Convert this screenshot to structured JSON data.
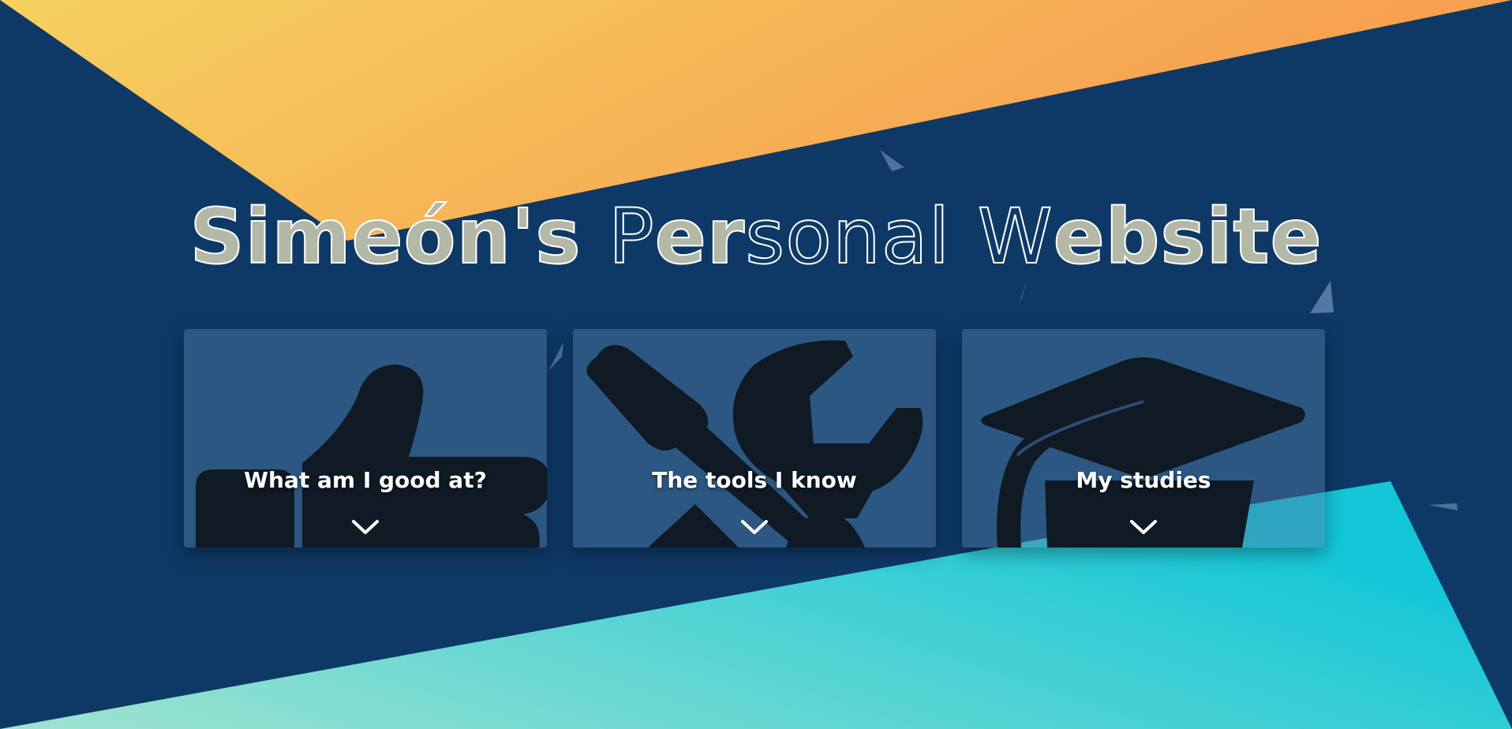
{
  "page": {
    "title_part1": "Simeón's",
    "title_part2": "P",
    "title_part3": "er",
    "title_part4": "sonal",
    "title_part5": "W",
    "title_part6": "ebsite"
  },
  "cards": [
    {
      "label": "What am I good at?",
      "icon": "thumbs-up-icon"
    },
    {
      "label": "The tools I know",
      "icon": "tools-icon"
    },
    {
      "label": "My studies",
      "icon": "graduation-cap-icon"
    }
  ],
  "colors": {
    "background": "#0e3966",
    "top_gradient_start": "#f5d25f",
    "top_gradient_end": "#f79a4f",
    "bottom_gradient_start": "#96e0cf",
    "bottom_gradient_end": "#15c8d8",
    "icon": "#0f1a25"
  }
}
